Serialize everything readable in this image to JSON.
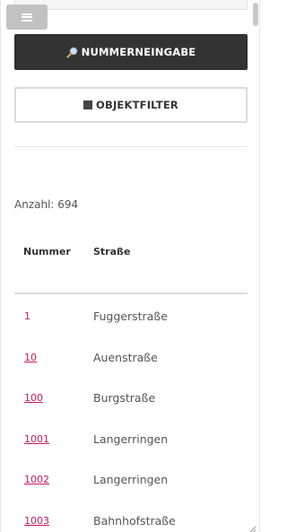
{
  "buttons": {
    "number_entry": {
      "label": "NUMMERNEINGABE",
      "icon": "magnifier-icon"
    },
    "object_filter": {
      "label": "OBJEKTFILTER",
      "icon": "square-icon"
    }
  },
  "count": {
    "label": "Anzahl: 694"
  },
  "table": {
    "headers": {
      "number": "Nummer",
      "street": "Straße"
    },
    "rows": [
      {
        "number": "1",
        "street": "Fuggerstraße"
      },
      {
        "number": "10",
        "street": "Auenstraße"
      },
      {
        "number": "100",
        "street": "Burgstraße"
      },
      {
        "number": "1001",
        "street": "Langerringen"
      },
      {
        "number": "1002",
        "street": "Langerringen"
      },
      {
        "number": "1003",
        "street": "Bahnhofstraße"
      }
    ]
  },
  "colors": {
    "primary_button": "#333333",
    "link": "#c2185b",
    "text": "#555555"
  }
}
